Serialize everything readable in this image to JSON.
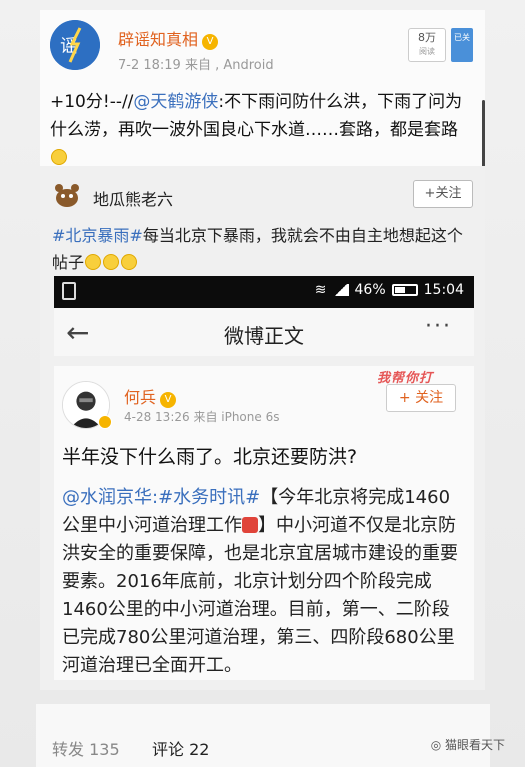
{
  "outer_post": {
    "author": "辟谣知真相",
    "meta": "7-2 18:19  来自 , Android",
    "views_value": "8万",
    "views_label": "阅读",
    "follow_side": "已关",
    "text_prefix": "+10分!--//",
    "text_mention": "@天鹤游侠",
    "text_body": ":不下雨问防什么洪，下雨了问为什么涝，再吹一波外国良心下水道……套路，都是套路"
  },
  "retweet": {
    "author": "地瓜熊老六",
    "follow": "+关注",
    "hashtag": "#北京暴雨#",
    "text": "每当北京下暴雨，我就会不由自主地想起这个帖子"
  },
  "phone": {
    "battery": "46%",
    "time": "15:04",
    "nav_title": "微博正文",
    "back_symbol": "←",
    "more_symbol": "···"
  },
  "inner_post": {
    "author": "何兵",
    "meta": "4-28 13:26  来自 iPhone 6s",
    "follow": "+ 关注",
    "watermark": "我帮你打",
    "headline": "半年没下什么雨了。北京还要防洪?",
    "mention": "@水润京华",
    "hashtag": ":#水务时讯#",
    "body_a": "【今年北京将完成1460公里中小河道治理工作",
    "body_b": "】中小河道不仅是北京防洪安全的重要保障，也是北京宜居城市建设的重要要素。2016年底前，北京计划分四个阶段完成1460公里的中小河道治理。目前，第一、二阶段已完成780公里河道治理，第三、四阶段680公里河道治理已全面开工。"
  },
  "bottom": {
    "repost": "转发 135",
    "comment": "评论 22",
    "watermark": "猫眼看天下"
  }
}
